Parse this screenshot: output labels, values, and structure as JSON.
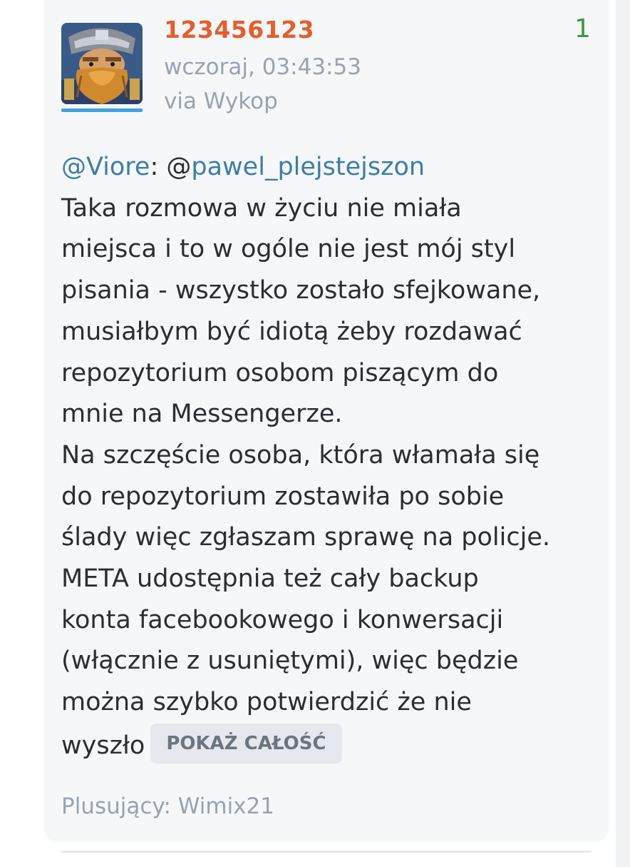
{
  "entry": {
    "author": "123456123",
    "vote_count": "1",
    "timestamp": "wczoraj, 03:43:53",
    "source": "via Wykop",
    "mention_1_prefix": "@",
    "mention_1": "Viore",
    "mention_sep": ": @",
    "mention_2": "pawel_plejstejszon",
    "lines": [
      "Taka rozmowa w życiu nie miała",
      "miejsca i to w ogóle nie jest mój styl",
      "pisania - wszystko zostało sfejkowane,",
      "musiałbym być idiotą żeby rozdawać",
      "repozytorium osobom piszącym do",
      "mnie na Messengerze.",
      "Na szczęście osoba, która włamała się",
      "do repozytorium zostawiła po sobie",
      "ślady więc zgłaszam sprawę na policje.",
      "META udostępnia też cały backup",
      "konta facebookowego i konwersacji",
      "(włącznie z usuniętymi), więc będzie",
      "można szybko potwierdzić że nie"
    ],
    "last_line": "wyszło",
    "show_all_label": "POKAŻ CAŁOŚĆ",
    "voters": "Plusujący: Wimix21"
  },
  "colors": {
    "author": "#e55e2d",
    "vote_count": "#3a9a3a",
    "mention": "#3d7ea6",
    "meta_text": "#98a3ad",
    "body_text": "#2a2e33",
    "card_bg": "#f6f7f9",
    "avatar_underline": "#3fa2e0"
  },
  "icons": {
    "avatar": "dwarf-warrior-avatar"
  }
}
